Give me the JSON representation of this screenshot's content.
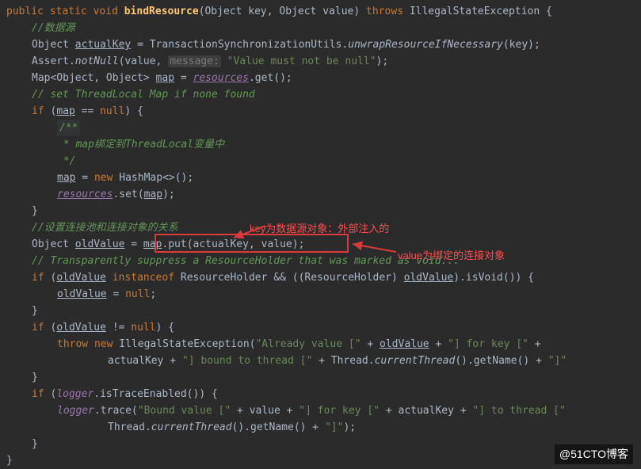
{
  "code": {
    "l1": {
      "kw_public": "public",
      "kw_static": "static",
      "kw_void": "void",
      "fn": "bindResource",
      "p1t": "Object",
      "p1n": "key",
      "p2t": "Object",
      "p2n": "value",
      "kw_throws": "throws",
      "exc": "IllegalStateException",
      "br": " {"
    },
    "l2": "//数据源",
    "l3": {
      "t1": "Object ",
      "v": "actualKey",
      "eq": " = TransactionSynchronizationUtils.",
      "m": "unwrapResourceIfNecessary",
      "args": "(key);"
    },
    "l4": {
      "cls": "Assert.",
      "m": "notNull",
      "open": "(value, ",
      "hint": "message:",
      "sp": " ",
      "str": "\"Value must not be null\"",
      "close": ");"
    },
    "l5": {
      "t": "Map<Object, Object> ",
      "v": "map",
      "eq": " = ",
      "fld": "resources",
      "call": ".get();"
    },
    "l6": "// set ThreadLocal Map if none found",
    "l7": {
      "kw": "if",
      "open": " (",
      "v": "map",
      "cmp": " == ",
      "nul": "null",
      "close": ") {"
    },
    "l8a": "/**",
    "l8b": {
      "pre": " * ",
      "txt1": "map绑定到",
      "em": "ThreadLocal",
      "txt2": "变量中"
    },
    "l8c": " */",
    "l9": {
      "v": "map",
      "eq": " = ",
      "kw": "new",
      "t": " HashMap<>();"
    },
    "l10": {
      "fld": "resources",
      "m": ".set(",
      "v": "map",
      "close": ");"
    },
    "l11": "}",
    "l12": "//设置连接池和连接对象的关系",
    "l13": {
      "t": "Object ",
      "v1": "oldValue",
      "eq": " = ",
      "v2": "map",
      "m": ".put(actualKey, value);"
    },
    "l14": "// Transparently suppress a ResourceHolder that was marked as void...",
    "l15": {
      "kw1": "if",
      "open": " (",
      "v1": "oldValue",
      "sp1": " ",
      "kw2": "instanceof",
      "t": " ResourceHolder && ((ResourceHolder) ",
      "v2": "oldValue",
      "call": ").isVoid()) {"
    },
    "l16": {
      "v": "oldValue",
      "eq": " = ",
      "nul": "null",
      "sc": ";"
    },
    "l17": "}",
    "l18": {
      "kw": "if",
      "open": " (",
      "v": "oldValue",
      "cmp": " != ",
      "nul": "null",
      "close": ") {"
    },
    "l19": {
      "kw1": "throw",
      "sp": " ",
      "kw2": "new",
      "t": " IllegalStateException(",
      "s1": "\"Already value [\"",
      "p1": " + ",
      "v": "oldValue",
      "p2": " + ",
      "s2": "\"] for key [\"",
      "p3": " + "
    },
    "l20": {
      "pre": "actualKey + ",
      "s1": "\"] bound to thread [\"",
      "p1": " + Thread.",
      "m": "currentThread",
      "call": "().getName() + ",
      "s2": "\"]\""
    },
    "l21": "}",
    "l22": {
      "kw": "if",
      "open": " (",
      "fld": "logger",
      "call": ".isTraceEnabled()) {"
    },
    "l23": {
      "fld": "logger",
      "m": ".trace(",
      "s1": "\"Bound value [\"",
      "p1": " + value + ",
      "s2": "\"] for key [\"",
      "p2": " + actualKey + ",
      "s3": "\"] to thread [\""
    },
    "l24": {
      "pre": "Thread.",
      "m": "currentThread",
      "call": "().getName() + ",
      "s": "\"]\"",
      "close": ");"
    },
    "l25": "}",
    "l26": "}"
  },
  "annotations": {
    "ann1": "key为数据源对象：外部注入的",
    "ann2": "value为绑定的连接对象"
  },
  "watermark": "@51CTO博客"
}
